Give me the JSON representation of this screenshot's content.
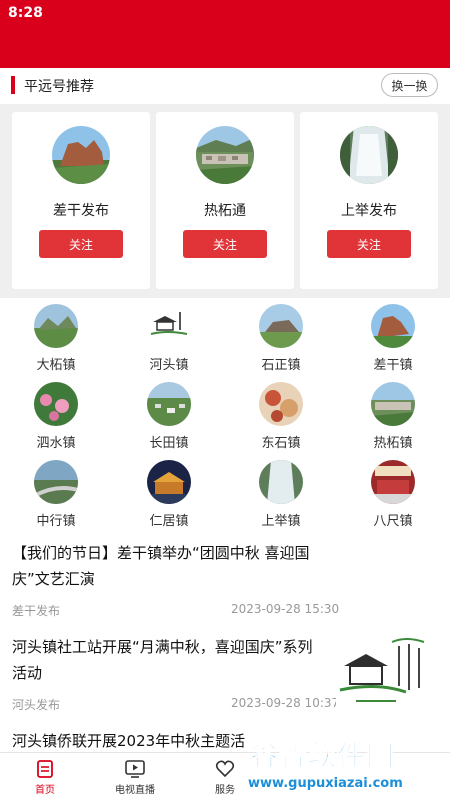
{
  "status_bar": {
    "time": "8:28"
  },
  "recommend": {
    "title": "平远号推荐",
    "swap_label": "换一换",
    "follow_label": "关注",
    "cards": [
      {
        "name": "差干发布"
      },
      {
        "name": "热柘通"
      },
      {
        "name": "上举发布"
      }
    ]
  },
  "towns": [
    {
      "name": "大柘镇"
    },
    {
      "name": "河头镇"
    },
    {
      "name": "石正镇"
    },
    {
      "name": "差干镇"
    },
    {
      "name": "泗水镇"
    },
    {
      "name": "长田镇"
    },
    {
      "name": "东石镇"
    },
    {
      "name": "热柘镇"
    },
    {
      "name": "中行镇"
    },
    {
      "name": "仁居镇"
    },
    {
      "name": "上举镇"
    },
    {
      "name": "八尺镇"
    }
  ],
  "news": [
    {
      "title_line1": "【我们的节日】差干镇举办“团圆中秋 喜迎国",
      "title_line2": "庆”文艺汇演",
      "source": "差干发布",
      "date": "2023-09-28 15:30"
    },
    {
      "title_line1": "河头镇社工站开展“月满中秋，喜迎国庆”系列",
      "title_line2": "活动",
      "source": "河头发布",
      "date": "2023-09-28 10:37"
    },
    {
      "title_line1": "河头镇侨联开展2023年中秋主题活"
    }
  ],
  "tabbar": {
    "items": [
      {
        "label": "首页"
      },
      {
        "label": "电视直播"
      },
      {
        "label": "服务"
      }
    ]
  },
  "watermark": {
    "brand": "谷普软件园",
    "url": "www.gupuxiazai.com"
  },
  "colors": {
    "brand_red": "#d9001b",
    "follow_red": "#e03438",
    "watermark_blue": "#1c8fd8"
  }
}
